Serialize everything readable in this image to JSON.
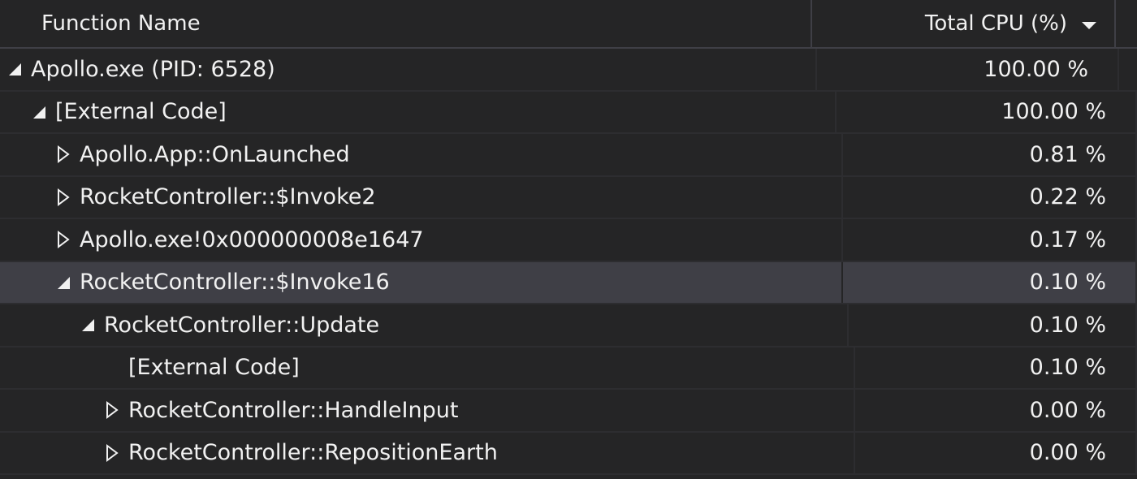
{
  "header": {
    "function_name": "Function Name",
    "total_cpu": "Total CPU (%)"
  },
  "rows": [
    {
      "name": "Apollo.exe (PID: 6528)",
      "cpu": "100.00 %",
      "level": 0,
      "state": "expanded",
      "selected": false
    },
    {
      "name": "[External Code]",
      "cpu": "100.00 %",
      "level": 1,
      "state": "expanded",
      "selected": false
    },
    {
      "name": "Apollo.App::OnLaunched",
      "cpu": "0.81 %",
      "level": 2,
      "state": "collapsed",
      "selected": false
    },
    {
      "name": "RocketController::$Invoke2",
      "cpu": "0.22 %",
      "level": 2,
      "state": "collapsed",
      "selected": false
    },
    {
      "name": "Apollo.exe!0x000000008e1647",
      "cpu": "0.17 %",
      "level": 2,
      "state": "collapsed",
      "selected": false
    },
    {
      "name": "RocketController::$Invoke16",
      "cpu": "0.10 %",
      "level": 2,
      "state": "expanded",
      "selected": true
    },
    {
      "name": "RocketController::Update",
      "cpu": "0.10 %",
      "level": 3,
      "state": "expanded",
      "selected": false
    },
    {
      "name": "[External Code]",
      "cpu": "0.10 %",
      "level": 4,
      "state": "none",
      "selected": false
    },
    {
      "name": "RocketController::HandleInput",
      "cpu": "0.00 %",
      "level": 4,
      "state": "collapsed",
      "selected": false
    },
    {
      "name": "RocketController::RepositionEarth",
      "cpu": "0.00 %",
      "level": 4,
      "state": "collapsed",
      "selected": false
    }
  ],
  "colors": {
    "background": "#252526",
    "selected": "#3f3f46",
    "text": "#f1f1f1",
    "gridline": "#2d2d30"
  },
  "icons": {
    "expanded": "expanded-triangle-icon",
    "collapsed": "collapsed-triangle-icon",
    "sort": "sort-descending-icon"
  }
}
